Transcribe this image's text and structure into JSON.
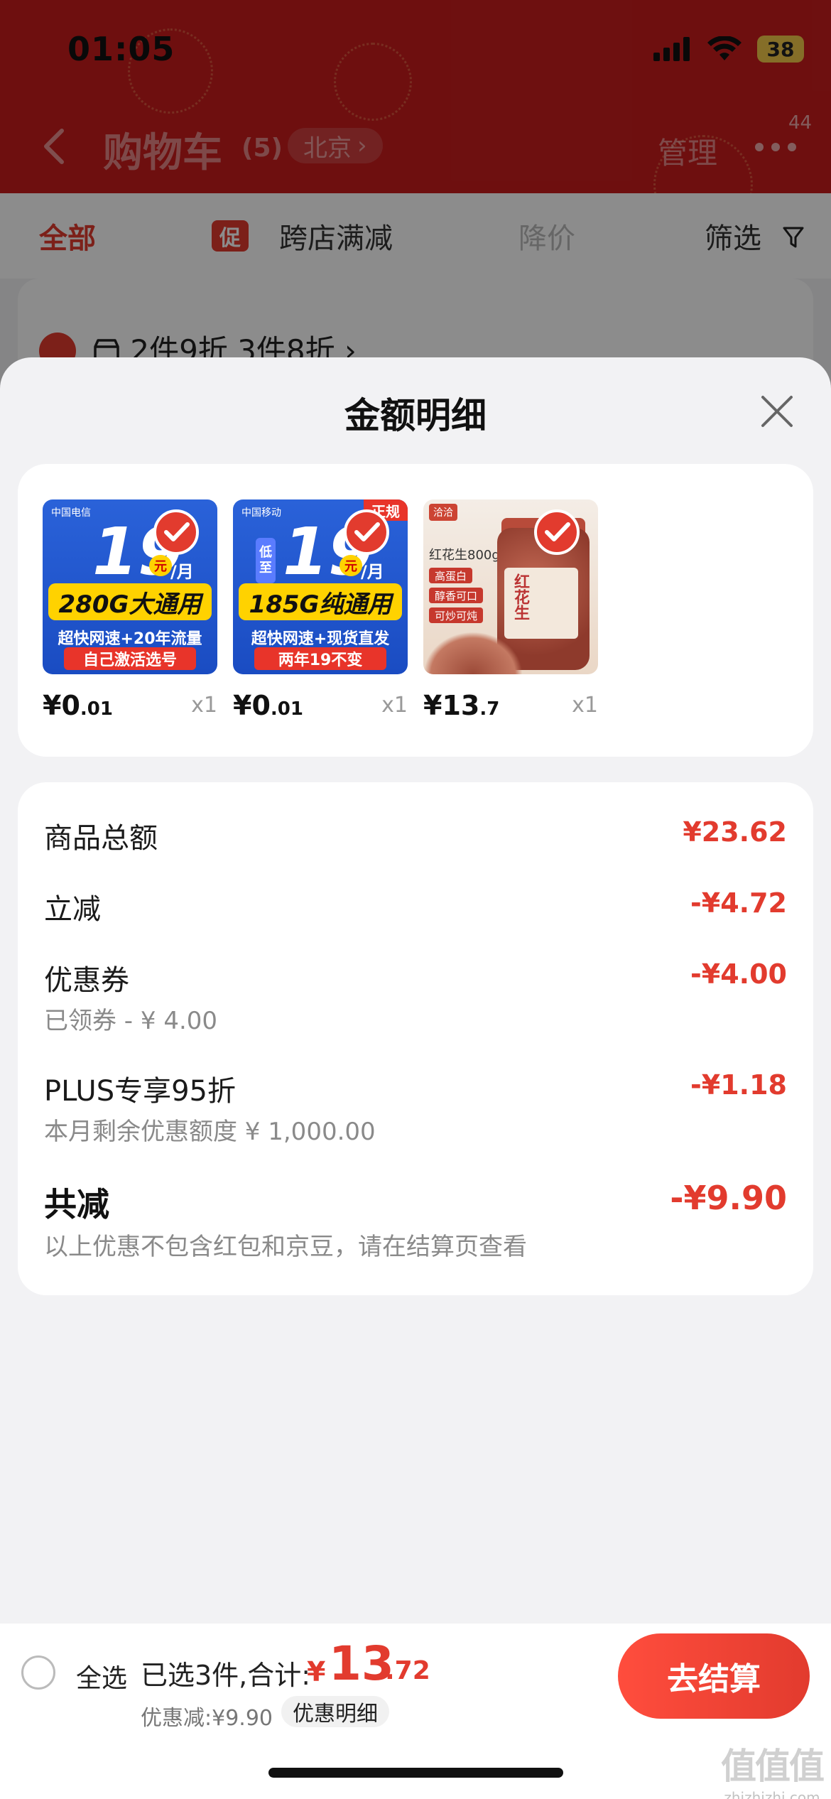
{
  "status_bar": {
    "time": "01:05",
    "battery": "38"
  },
  "header": {
    "title": "购物车",
    "count": "(5)",
    "location": "北京",
    "manage": "管理",
    "more_badge": "44"
  },
  "tabs": {
    "all": "全部",
    "promo_tag": "促",
    "cross_store": "跨店满减",
    "price_drop": "降价",
    "filter": "筛选"
  },
  "behind_promo": "2件9折 3件8折 ›",
  "sheet": {
    "title": "金额明细",
    "products": [
      {
        "price_int": "¥0",
        "price_dec": ".01",
        "qty": "x1",
        "thumb": {
          "big": "19",
          "yuan": "元",
          "month": "/月",
          "banner": "280G大通用",
          "line": "超快网速+20年流量",
          "red": "自己激活选号",
          "logo": "中国电信"
        }
      },
      {
        "price_int": "¥0",
        "price_dec": ".01",
        "qty": "x1",
        "thumb": {
          "big": "19",
          "yuan": "元",
          "month": "/月",
          "banner": "185G纯通用",
          "line": "超快网速+现货直发",
          "red": "两年19不变",
          "logo": "中国移动",
          "low": "低至",
          "corner": "正规"
        }
      },
      {
        "price_int": "¥13",
        "price_dec": ".7",
        "qty": "x1",
        "thumb": {
          "brand": "洽洽",
          "name": "红花生800g",
          "tags": [
            "高蛋白",
            "醇香可口",
            "可炒可炖"
          ],
          "jar_text": "红花生"
        }
      }
    ],
    "rows": [
      {
        "label": "商品总额",
        "value": "¥23.62",
        "sub": ""
      },
      {
        "label": "立减",
        "value": "-¥4.72",
        "sub": ""
      },
      {
        "label": "优惠券",
        "value": "-¥4.00",
        "sub": "已领券 - ¥ 4.00"
      },
      {
        "label": "PLUS专享95折",
        "value": "-¥1.18",
        "sub": "本月剩余优惠额度 ¥ 1,000.00"
      }
    ],
    "total": {
      "label": "共减",
      "value": "-¥9.90",
      "note": "以上优惠不包含红包和京豆，请在结算页查看"
    }
  },
  "bottom": {
    "select_all": "全选",
    "selected_info": "已选3件,合计:",
    "total_yen": "¥",
    "total_int": "13",
    "total_dec": ".72",
    "discount": "优惠减:¥9.90",
    "detail_chip": "优惠明细",
    "checkout": "去结算"
  },
  "watermark": {
    "big": "值值值",
    "small": "zhizhizhi.com"
  },
  "colors": {
    "accent": "#e23b2e",
    "header_bg": "#c81d1d",
    "sheet_bg": "#f2f2f4"
  }
}
